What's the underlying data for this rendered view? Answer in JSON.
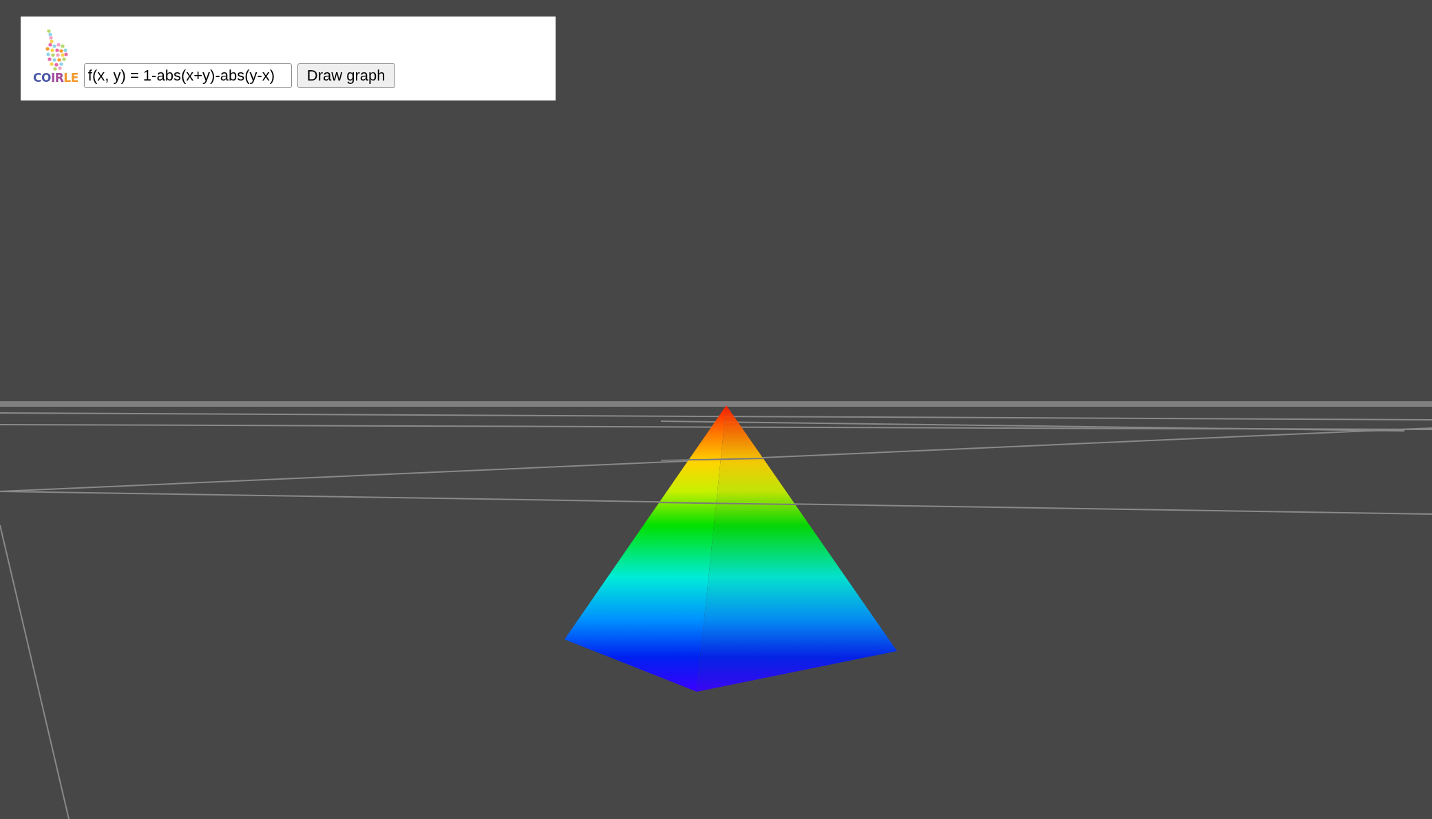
{
  "logo": {
    "parts": [
      {
        "text": "CO",
        "color": "#4a58a8"
      },
      {
        "text": "IR",
        "color": "#a24a9c"
      },
      {
        "text": "LE",
        "color": "#f29a2e"
      }
    ]
  },
  "formula_field": {
    "value": "f(x, y) = 1-abs(x+y)-abs(y-x)"
  },
  "draw_button": {
    "label": "Draw graph"
  }
}
